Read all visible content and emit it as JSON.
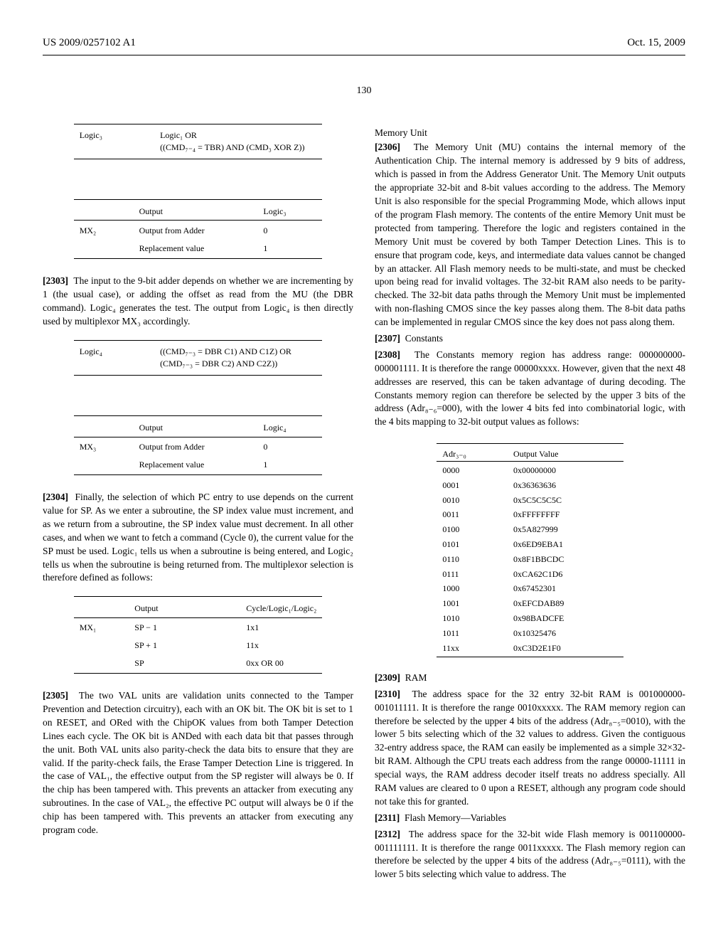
{
  "header": {
    "left": "US 2009/0257102 A1",
    "right": "Oct. 15, 2009"
  },
  "page_num": "130",
  "left_col": {
    "table1": {
      "r1c1": "Logic₃",
      "r1c2": "Logic₁ OR",
      "r1c3": "((CMD₇₋₄ = TBR) AND (CMD₃ XOR Z))"
    },
    "table2": {
      "h2": "Output",
      "h3": "Logic₃",
      "r1c1": "MX₂",
      "r1c2": "Output from Adder",
      "r1c3": "0",
      "r2c2": "Replacement value",
      "r2c3": "1"
    },
    "p2303_num": "[2303]",
    "p2303": "The input to the 9-bit adder depends on whether we are incrementing by 1 (the usual case), or adding the offset as read from the MU (the DBR command). Logic₄ generates the test. The output from Logic₄ is then directly used by multiplexor MX₃ accordingly.",
    "table3": {
      "r1c1": "Logic₄",
      "r1c2": "((CMD₇₋₃ = DBR C1) AND C1Z) OR",
      "r1c3": "(CMD₇₋₃ = DBR C2) AND C2Z))"
    },
    "table4": {
      "h2": "Output",
      "h3": "Logic₄",
      "r1c1": "MX₃",
      "r1c2": "Output from Adder",
      "r1c3": "0",
      "r2c2": "Replacement value",
      "r2c3": "1"
    },
    "p2304_num": "[2304]",
    "p2304": "Finally, the selection of which PC entry to use depends on the current value for SP. As we enter a subroutine, the SP index value must increment, and as we return from a subroutine, the SP index value must decrement. In all other cases, and when we want to fetch a command (Cycle 0), the current value for the SP must be used. Logic₁ tells us when a subroutine is being entered, and Logic₂ tells us when the subroutine is being returned from. The multiplexor selection is therefore defined as follows:",
    "table5": {
      "h2": "Output",
      "h3": "Cycle/Logic₁/Logic₂",
      "r1c1": "MX₁",
      "r1c2": "SP − 1",
      "r1c3": "1x1",
      "r2c2": "SP + 1",
      "r2c3": "11x",
      "r3c2": "SP",
      "r3c3": "0xx OR 00"
    },
    "p2305_num": "[2305]",
    "p2305": "The two VAL units are validation units connected to the Tamper Prevention and Detection circuitry), each with an OK bit. The OK bit is set to 1 on RESET, and ORed with the ChipOK values from both Tamper Detection Lines each cycle. The OK bit is ANDed with each data bit that passes through the unit. Both VAL units also parity-check the data bits to ensure that they are valid. If the parity-check fails, the Erase Tamper Detection Line is triggered. In the case of VAL₁, the effective output from the SP register will always be 0. If the chip has been tampered with. This prevents an attacker from executing any subroutines. In the case of VAL₂, the effective PC output will always be 0 if the chip has been tampered with. This prevents an attacker from executing any program code."
  },
  "right_col": {
    "mem_head": "Memory Unit",
    "p2306_num": "[2306]",
    "p2306": "The Memory Unit (MU) contains the internal memory of the Authentication Chip. The internal memory is addressed by 9 bits of address, which is passed in from the Address Generator Unit. The Memory Unit outputs the appropriate 32-bit and 8-bit values according to the address. The Memory Unit is also responsible for the special Programming Mode, which allows input of the program Flash memory. The contents of the entire Memory Unit must be protected from tampering. Therefore the logic and registers contained in the Memory Unit must be covered by both Tamper Detection Lines. This is to ensure that program code, keys, and intermediate data values cannot be changed by an attacker. All Flash memory needs to be multi-state, and must be checked upon being read for invalid voltages. The 32-bit RAM also needs to be parity-checked. The 32-bit data paths through the Memory Unit must be implemented with non-flashing CMOS since the key passes along them. The 8-bit data paths can be implemented in regular CMOS since the key does not pass along them.",
    "p2307_num": "[2307]",
    "p2307": "Constants",
    "p2308_num": "[2308]",
    "p2308": "The Constants memory region has address range: 000000000-000001111. It is therefore the range 00000xxxx. However, given that the next 48 addresses are reserved, this can be taken advantage of during decoding. The Constants memory region can therefore be selected by the upper 3 bits of the address (Adr₈₋₆=000), with the lower 4 bits fed into combinatorial logic, with the 4 bits mapping to 32-bit output values as follows:",
    "const_table": {
      "h1": "Adr₃₋₀",
      "h2": "Output Value",
      "rows": [
        [
          "0000",
          "0x00000000"
        ],
        [
          "0001",
          "0x36363636"
        ],
        [
          "0010",
          "0x5C5C5C5C"
        ],
        [
          "0011",
          "0xFFFFFFFF"
        ],
        [
          "0100",
          "0x5A827999"
        ],
        [
          "0101",
          "0x6ED9EBA1"
        ],
        [
          "0110",
          "0x8F1BBCDC"
        ],
        [
          "0111",
          "0xCA62C1D6"
        ],
        [
          "1000",
          "0x67452301"
        ],
        [
          "1001",
          "0xEFCDAB89"
        ],
        [
          "1010",
          "0x98BADCFE"
        ],
        [
          "1011",
          "0x10325476"
        ],
        [
          "11xx",
          "0xC3D2E1F0"
        ]
      ]
    },
    "p2309_num": "[2309]",
    "p2309": "RAM",
    "p2310_num": "[2310]",
    "p2310": "The address space for the 32 entry 32-bit RAM is 001000000-001011111. It is therefore the range 0010xxxxx. The RAM memory region can therefore be selected by the upper 4 bits of the address (Adr₈₋₅=0010), with the lower 5 bits selecting which of the 32 values to address. Given the contiguous 32-entry address space, the RAM can easily be implemented as a simple 32×32-bit RAM. Although the CPU treats each address from the range 00000-11111 in special ways, the RAM address decoder itself treats no address specially. All RAM values are cleared to 0 upon a RESET, although any program code should not take this for granted.",
    "p2311_num": "[2311]",
    "p2311": "Flash Memory—Variables",
    "p2312_num": "[2312]",
    "p2312": "The address space for the 32-bit wide Flash memory is 001100000-001111111. It is therefore the range 0011xxxxx. The Flash memory region can therefore be selected by the upper 4 bits of the address (Adr₈₋₅=0111), with the lower 5 bits selecting which value to address. The"
  }
}
